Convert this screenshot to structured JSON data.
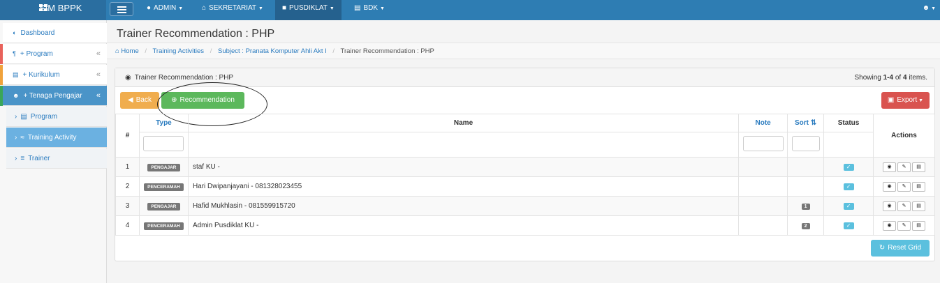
{
  "app": {
    "brand": "SIM BPPK"
  },
  "topnav": {
    "items": [
      {
        "label": "ADMIN",
        "icon": "android-icon"
      },
      {
        "label": "SEKRETARIAT",
        "icon": "home-icon"
      },
      {
        "label": "PUSDIKLAT",
        "icon": "book-icon"
      },
      {
        "label": "BDK",
        "icon": "institution-icon"
      }
    ],
    "user_icon": "user-icon"
  },
  "sidebar": {
    "items": [
      {
        "label": "Dashboard",
        "icon": "dashboard-icon"
      },
      {
        "label": "+ Program",
        "icon": "pilcrow-icon",
        "accent": "#e8625b"
      },
      {
        "label": "+ Kurikulum",
        "icon": "institution-icon",
        "accent": "#f0a23b"
      },
      {
        "label": "+ Tenaga Pengajar",
        "icon": "users-icon",
        "accent": "#3aa65a"
      }
    ],
    "subitems": [
      {
        "label": "Program",
        "icon": "list-icon"
      },
      {
        "label": "Training Activity",
        "icon": "activity-icon"
      },
      {
        "label": "Trainer",
        "icon": "list-icon"
      }
    ]
  },
  "page": {
    "title": "Trainer Recommendation : PHP"
  },
  "breadcrumb": [
    "Home",
    "Training Activities",
    "Subject : Pranata Komputer Ahli Akt I",
    "Trainer Recommendation : PHP"
  ],
  "panel": {
    "title": "Trainer Recommendation : PHP",
    "showing_prefix": "Showing ",
    "showing_range": "1-4",
    "showing_of": " of ",
    "showing_total": "4",
    "showing_suffix": " items.",
    "back_label": "Back",
    "recommendation_label": "Recommendation",
    "export_label": "Export",
    "reset_label": "Reset Grid"
  },
  "table": {
    "headers": {
      "num": "#",
      "type": "Type",
      "name": "Name",
      "note": "Note",
      "sort": "Sort",
      "status": "Status",
      "actions": "Actions"
    },
    "rows": [
      {
        "num": "1",
        "type": "PENGAJAR",
        "name": "staf KU -",
        "sort": ""
      },
      {
        "num": "2",
        "type": "PENCERAMAH",
        "name": "Hari Dwipanjayani - 081328023455",
        "sort": ""
      },
      {
        "num": "3",
        "type": "PENGAJAR",
        "name": "Hafid Mukhlasin - 081559915720",
        "sort": "1"
      },
      {
        "num": "4",
        "type": "PENCERAMAH",
        "name": "Admin Pusdiklat KU -",
        "sort": "2"
      }
    ]
  },
  "colors": {
    "navbar": "#2e7db3",
    "back": "#f0ad4e",
    "recommend": "#5cb85c",
    "export": "#d9534f",
    "reset": "#5bc0de"
  }
}
